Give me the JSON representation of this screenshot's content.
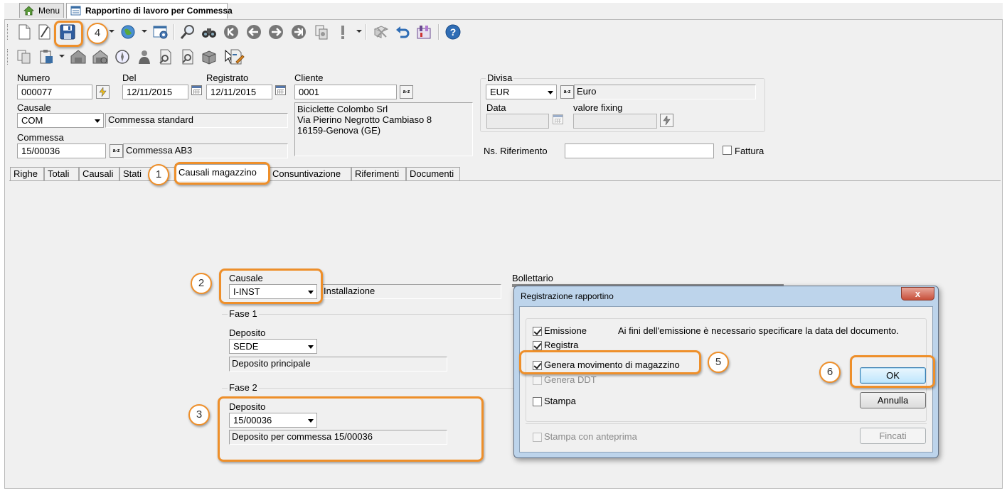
{
  "window_tabs": [
    {
      "label": "Menu"
    },
    {
      "label": "Rapportino di lavoro per Commessa"
    }
  ],
  "header": {
    "numero_label": "Numero",
    "numero_value": "000077",
    "del_label": "Del",
    "del_value": "12/11/2015",
    "registrato_label": "Registrato",
    "registrato_value": "12/11/2015",
    "cliente_label": "Cliente",
    "cliente_value": "0001",
    "cliente_address": [
      "Biciclette Colombo Srl",
      "Via Pierino Negrotto Cambiaso 8",
      "16159-Genova (GE)"
    ],
    "causale_label": "Causale",
    "causale_value": "COM",
    "causale_desc": "Commessa standard",
    "commessa_label": "Commessa",
    "commessa_value": "15/00036",
    "commessa_desc": "Commessa AB3",
    "divisa_label": "Divisa",
    "divisa_value": "EUR",
    "divisa_desc": "Euro",
    "data_label": "Data",
    "data_value": "",
    "fixing_label": "valore fixing",
    "fixing_value": "",
    "ns_rif_label": "Ns. Riferimento",
    "ns_rif_value": "",
    "fattura_label": "Fattura",
    "lookup_icon_text": "a-z"
  },
  "page_tabs": [
    {
      "label": "Righe"
    },
    {
      "label": "Totali"
    },
    {
      "label": "Causali"
    },
    {
      "label": "Stati"
    },
    {
      "label": "Causali magazzino"
    },
    {
      "label": "Consuntivazione"
    },
    {
      "label": "Riferimenti"
    },
    {
      "label": "Documenti"
    }
  ],
  "tab_content": {
    "causale_label": "Causale",
    "causale_value": "I-INST",
    "causale_desc": "Installazione",
    "bollettario_label": "Bollettario",
    "fase1_label": "Fase 1",
    "fase1_deposito_label": "Deposito",
    "fase1_deposito_value": "SEDE",
    "fase1_deposito_desc": "Deposito principale",
    "fase2_label": "Fase 2",
    "fase2_deposito_label": "Deposito",
    "fase2_deposito_value": "15/00036",
    "fase2_deposito_desc": "Deposito per commessa 15/00036"
  },
  "dialog": {
    "title": "Registrazione rapportino",
    "close_label": "x",
    "message": "Ai fini dell'emissione è necessario specificare la data del documento.",
    "options": [
      {
        "label": "Emissione",
        "checked": true,
        "disabled": false
      },
      {
        "label": "Registra",
        "checked": true,
        "disabled": false
      },
      {
        "label": "Genera movimento di magazzino",
        "checked": true,
        "disabled": false
      },
      {
        "label": "Genera DDT",
        "checked": false,
        "disabled": true
      },
      {
        "label": "Stampa",
        "checked": false,
        "disabled": false
      }
    ],
    "anteprima_label": "Stampa con anteprima",
    "ok_label": "OK",
    "annulla_label": "Annulla",
    "fincati_label": "Fincati"
  },
  "callouts": [
    "1",
    "2",
    "3",
    "4",
    "5",
    "6"
  ],
  "colors": {
    "highlight": "#ee8f2a",
    "dialog_frame": "#b9d1ea",
    "ok_button": "#bee6fd"
  }
}
